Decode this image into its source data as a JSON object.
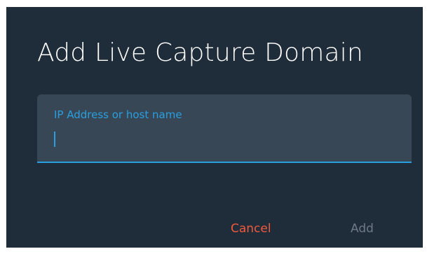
{
  "dialog": {
    "title": "Add Live Capture Domain",
    "field": {
      "label": "IP Address or host name",
      "value": "",
      "placeholder": ""
    },
    "actions": {
      "cancel_label": "Cancel",
      "add_label": "Add"
    }
  },
  "colors": {
    "dialog_background": "#1f2c39",
    "field_background": "#374755",
    "accent": "#2a9fe0",
    "cancel": "#f05a3c",
    "disabled_text": "#6d7a86"
  }
}
